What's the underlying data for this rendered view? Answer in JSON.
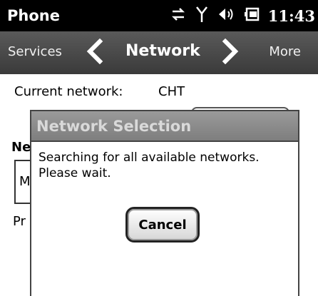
{
  "status_bar": {
    "app_title": "Phone",
    "time": "11:43",
    "icons": [
      "data-transfer-icon",
      "signal-icon",
      "volume-icon",
      "battery-icon"
    ]
  },
  "nav": {
    "left_label": "Services",
    "title": "Network",
    "right_label": "More"
  },
  "content": {
    "current_network_label": "Current network:",
    "current_network_value": "CHT",
    "section_heading_partial": "Ne",
    "select_partial": "M",
    "text_partial": "Pr"
  },
  "dialog": {
    "title": "Network Selection",
    "message_line1": "Searching for all available networks.",
    "message_line2": "Please wait.",
    "cancel_label": "Cancel"
  },
  "colors": {
    "status_bar_bg": "#000000",
    "nav_bar_bg": "#4a4a4a",
    "dialog_title_bg": "#8a8a8a",
    "dialog_title_text": "#d9d9d9"
  }
}
